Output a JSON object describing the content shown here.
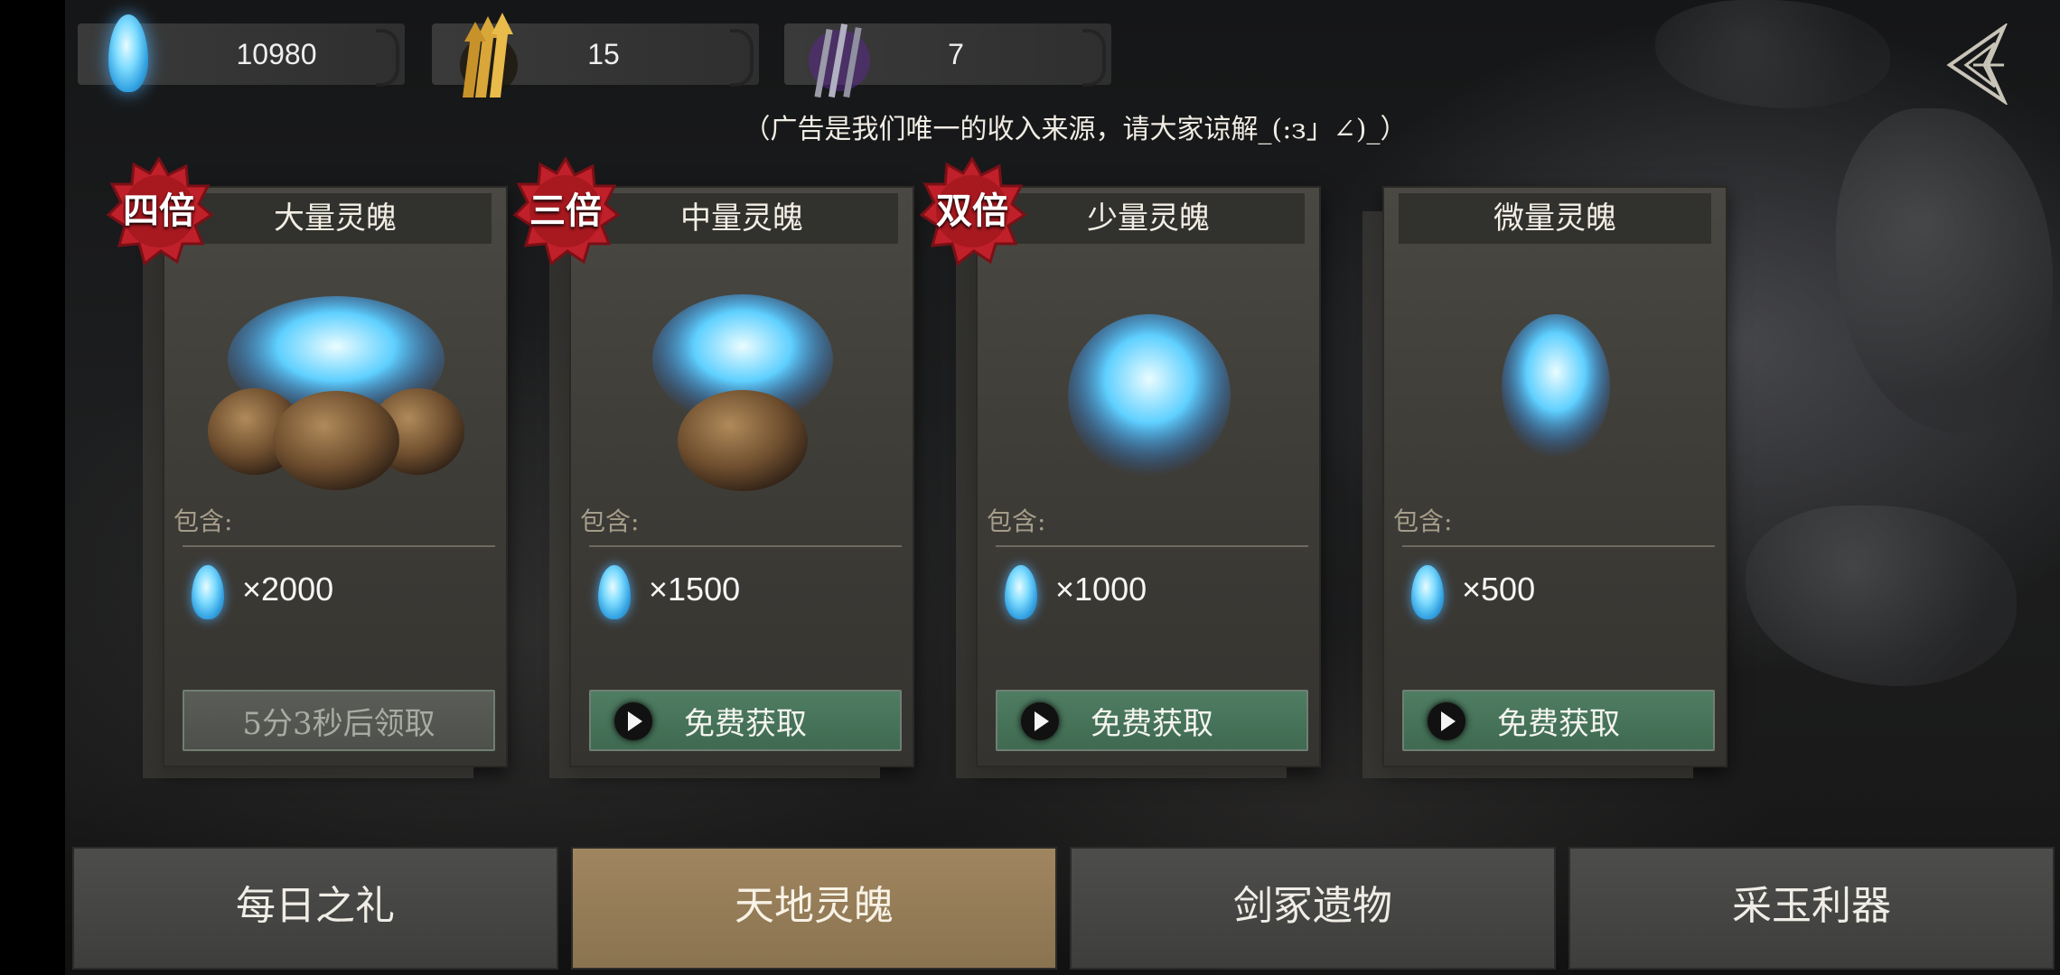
{
  "currencies": [
    {
      "name": "soul-crystal",
      "value": "10980"
    },
    {
      "name": "golden-arrows",
      "value": "15"
    },
    {
      "name": "purple-arrows",
      "value": "7"
    }
  ],
  "notice": "（广告是我们唯一的收入来源，请大家谅解_(:з」∠)_）",
  "cards": [
    {
      "badge": "四倍",
      "title": "大量灵魄",
      "contains_label": "包含:",
      "quantity": "×2000",
      "button": "5分3秒后领取",
      "button_state": "disabled"
    },
    {
      "badge": "三倍",
      "title": "中量灵魄",
      "contains_label": "包含:",
      "quantity": "×1500",
      "button": "免费获取",
      "button_state": "enabled"
    },
    {
      "badge": "双倍",
      "title": "少量灵魄",
      "contains_label": "包含:",
      "quantity": "×1000",
      "button": "免费获取",
      "button_state": "enabled"
    },
    {
      "badge": "",
      "title": "微量灵魄",
      "contains_label": "包含:",
      "quantity": "×500",
      "button": "免费获取",
      "button_state": "enabled"
    }
  ],
  "tabs": [
    {
      "label": "每日之礼",
      "active": false
    },
    {
      "label": "天地灵魄",
      "active": true
    },
    {
      "label": "剑冢遗物",
      "active": false
    },
    {
      "label": "采玉利器",
      "active": false
    }
  ],
  "colors": {
    "accent_green": "#4f7d62",
    "active_tab": "#a08660",
    "badge_red": "#c0202a",
    "soul_blue": "#4fb8ff"
  },
  "icons": {
    "back": "back-arrow-icon",
    "play": "play-icon",
    "soul": "soul-crystal-icon"
  }
}
